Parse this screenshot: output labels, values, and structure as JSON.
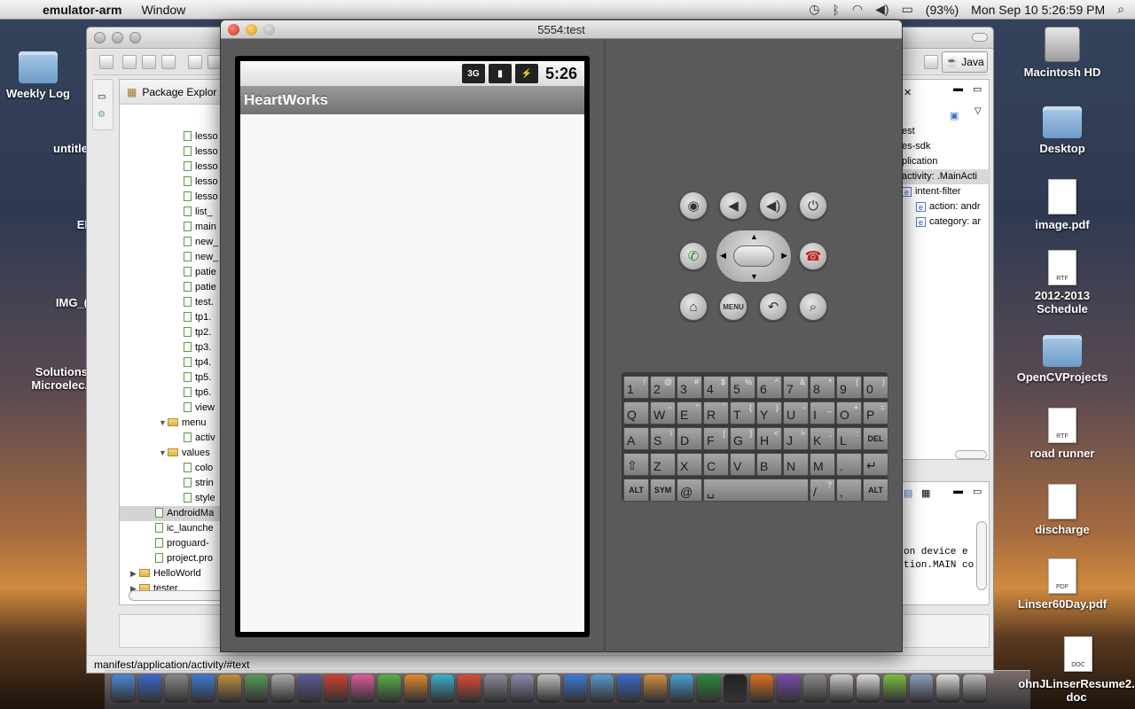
{
  "menubar": {
    "app_name": "emulator-arm",
    "menu_window": "Window",
    "battery": "(93%)",
    "datetime": "Mon Sep 10  5:26:59 PM"
  },
  "desktop": {
    "left_icons": [
      "Weekly Log",
      "untitle",
      "El",
      "IMG_(",
      "Solutions\nMicroelec."
    ],
    "right_icons": [
      "Macintosh HD",
      "Desktop",
      "image.pdf",
      "2012-2013 Schedule",
      "OpenCVProjects",
      "road runner",
      "discharge",
      "Linser60Day.pdf",
      "ohnJLinserResume2.\ndoc"
    ]
  },
  "eclipse": {
    "package_explorer_title": "Package Explor",
    "perspective": "Java",
    "tree": [
      {
        "label": "lesso",
        "type": "file",
        "indent": 2
      },
      {
        "label": "lesso",
        "type": "file",
        "indent": 2
      },
      {
        "label": "lesso",
        "type": "file",
        "indent": 2
      },
      {
        "label": "lesso",
        "type": "file",
        "indent": 2
      },
      {
        "label": "lesso",
        "type": "file",
        "indent": 2
      },
      {
        "label": "list_",
        "type": "file",
        "indent": 2
      },
      {
        "label": "main",
        "type": "file",
        "indent": 2
      },
      {
        "label": "new_",
        "type": "file",
        "indent": 2
      },
      {
        "label": "new_",
        "type": "file",
        "indent": 2
      },
      {
        "label": "patie",
        "type": "file",
        "indent": 2
      },
      {
        "label": "patie",
        "type": "file",
        "indent": 2
      },
      {
        "label": "test.",
        "type": "file",
        "indent": 2
      },
      {
        "label": "tp1.",
        "type": "file",
        "indent": 2
      },
      {
        "label": "tp2.",
        "type": "file",
        "indent": 2
      },
      {
        "label": "tp3.",
        "type": "file",
        "indent": 2
      },
      {
        "label": "tp4.",
        "type": "file",
        "indent": 2
      },
      {
        "label": "tp5.",
        "type": "file",
        "indent": 2
      },
      {
        "label": "tp6.",
        "type": "file",
        "indent": 2
      },
      {
        "label": "view",
        "type": "file",
        "indent": 2
      },
      {
        "label": "menu",
        "type": "folder",
        "indent": 1
      },
      {
        "label": "activ",
        "type": "file",
        "indent": 2
      },
      {
        "label": "values",
        "type": "folder",
        "indent": 1
      },
      {
        "label": "colo",
        "type": "file",
        "indent": 2
      },
      {
        "label": "strin",
        "type": "file",
        "indent": 2
      },
      {
        "label": "style",
        "type": "file",
        "indent": 2
      },
      {
        "label": "AndroidMa",
        "type": "file",
        "indent": 0,
        "selected": true
      },
      {
        "label": "ic_launche",
        "type": "file",
        "indent": 0
      },
      {
        "label": "proguard-",
        "type": "file",
        "indent": 0
      },
      {
        "label": "project.pro",
        "type": "file",
        "indent": 0
      },
      {
        "label": "HelloWorld",
        "type": "project",
        "indent": -1
      },
      {
        "label": "tester",
        "type": "project",
        "indent": -1
      }
    ],
    "outline": [
      "est",
      "es-sdk",
      "plication",
      "activity: .MainActi",
      "intent-filter",
      "action: andr",
      "category: ar"
    ],
    "console": [
      "on device e",
      "tion.MAIN co"
    ],
    "status_path": "manifest/application/activity/#text"
  },
  "emulator": {
    "window_title": "5554:test",
    "status_time": "5:26",
    "network_label": "3G",
    "app_title": "HeartWorks",
    "keyboard": {
      "row1": [
        [
          "1",
          "!"
        ],
        [
          "2",
          "@"
        ],
        [
          "3",
          "#"
        ],
        [
          "4",
          "$"
        ],
        [
          "5",
          "%"
        ],
        [
          "6",
          "^"
        ],
        [
          "7",
          "&"
        ],
        [
          "8",
          "*"
        ],
        [
          "9",
          "("
        ],
        [
          "0",
          ")"
        ]
      ],
      "row2": [
        [
          "Q",
          ""
        ],
        [
          "W",
          "~"
        ],
        [
          "E",
          "\""
        ],
        [
          "R",
          "`"
        ],
        [
          "T",
          "{"
        ],
        [
          "Y",
          "}"
        ],
        [
          "U",
          "-"
        ],
        [
          "I",
          "_"
        ],
        [
          "O",
          "+"
        ],
        [
          "P",
          "="
        ]
      ],
      "row3": [
        [
          "A",
          ""
        ],
        [
          "S",
          "\\"
        ],
        [
          "D",
          ""
        ],
        [
          "F",
          "["
        ],
        [
          "G",
          "]"
        ],
        [
          "H",
          "<"
        ],
        [
          "J",
          ">"
        ],
        [
          "K",
          ";"
        ],
        [
          "L",
          ":"
        ],
        [
          "DEL",
          ""
        ]
      ],
      "row4": [
        [
          "⇧",
          ""
        ],
        [
          "Z",
          ""
        ],
        [
          "X",
          ""
        ],
        [
          "C",
          ""
        ],
        [
          "V",
          ""
        ],
        [
          "B",
          ""
        ],
        [
          "N",
          ""
        ],
        [
          "M",
          ""
        ],
        [
          ".",
          ""
        ],
        [
          "↵",
          ""
        ]
      ],
      "row5": [
        [
          "ALT",
          ""
        ],
        [
          "SYM",
          ""
        ],
        [
          "@",
          ""
        ],
        [
          "␣",
          ""
        ],
        [
          "/",
          "?"
        ],
        [
          ",",
          ""
        ],
        [
          "ALT",
          ""
        ]
      ]
    },
    "hw_buttons": {
      "menu": "MENU"
    }
  }
}
